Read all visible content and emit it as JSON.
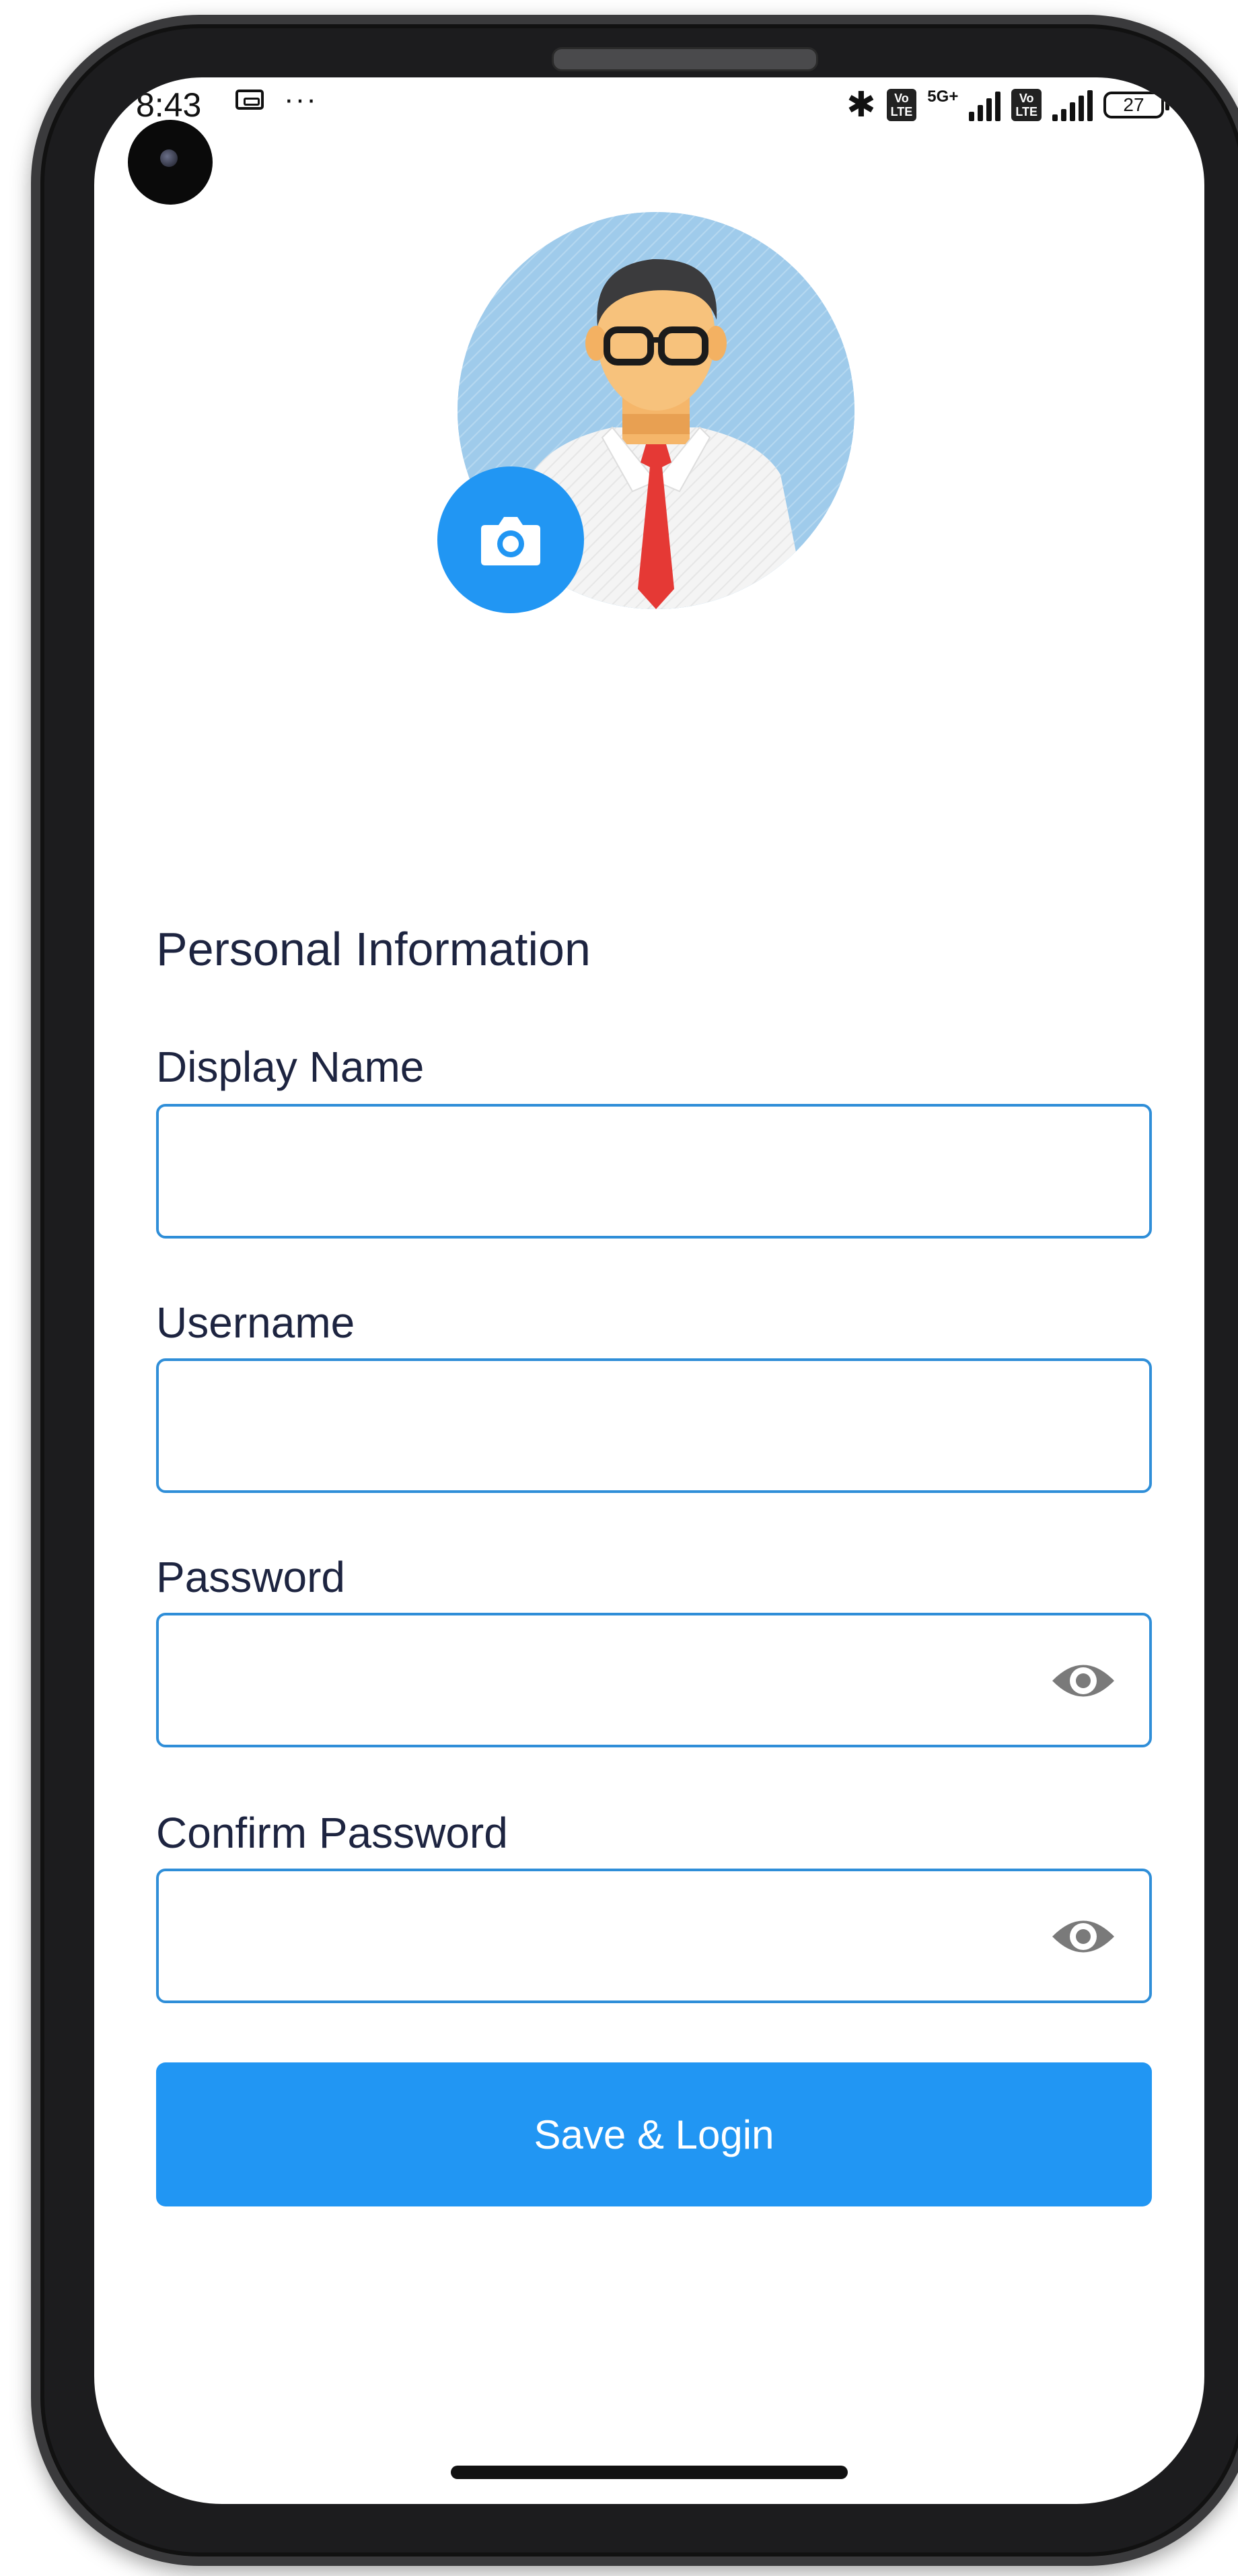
{
  "status_bar": {
    "time": "8:43",
    "network": "5G+",
    "battery": "27"
  },
  "profile": {
    "avatar_icon": "man-with-glasses-avatar",
    "camera_icon": "camera-icon"
  },
  "form": {
    "section_title": "Personal Information",
    "fields": [
      {
        "label": "Display Name",
        "value": "",
        "type": "text"
      },
      {
        "label": "Username",
        "value": "",
        "type": "text"
      },
      {
        "label": "Password",
        "value": "",
        "type": "password",
        "icon": "eye-icon"
      },
      {
        "label": "Confirm Password",
        "value": "",
        "type": "password",
        "icon": "eye-icon"
      }
    ],
    "submit_label": "Save & Login"
  },
  "colors": {
    "accent": "#2196f3",
    "input_border": "#2f8ed8",
    "text": "#1d2440",
    "avatar_bg": "#9fcbeb"
  }
}
